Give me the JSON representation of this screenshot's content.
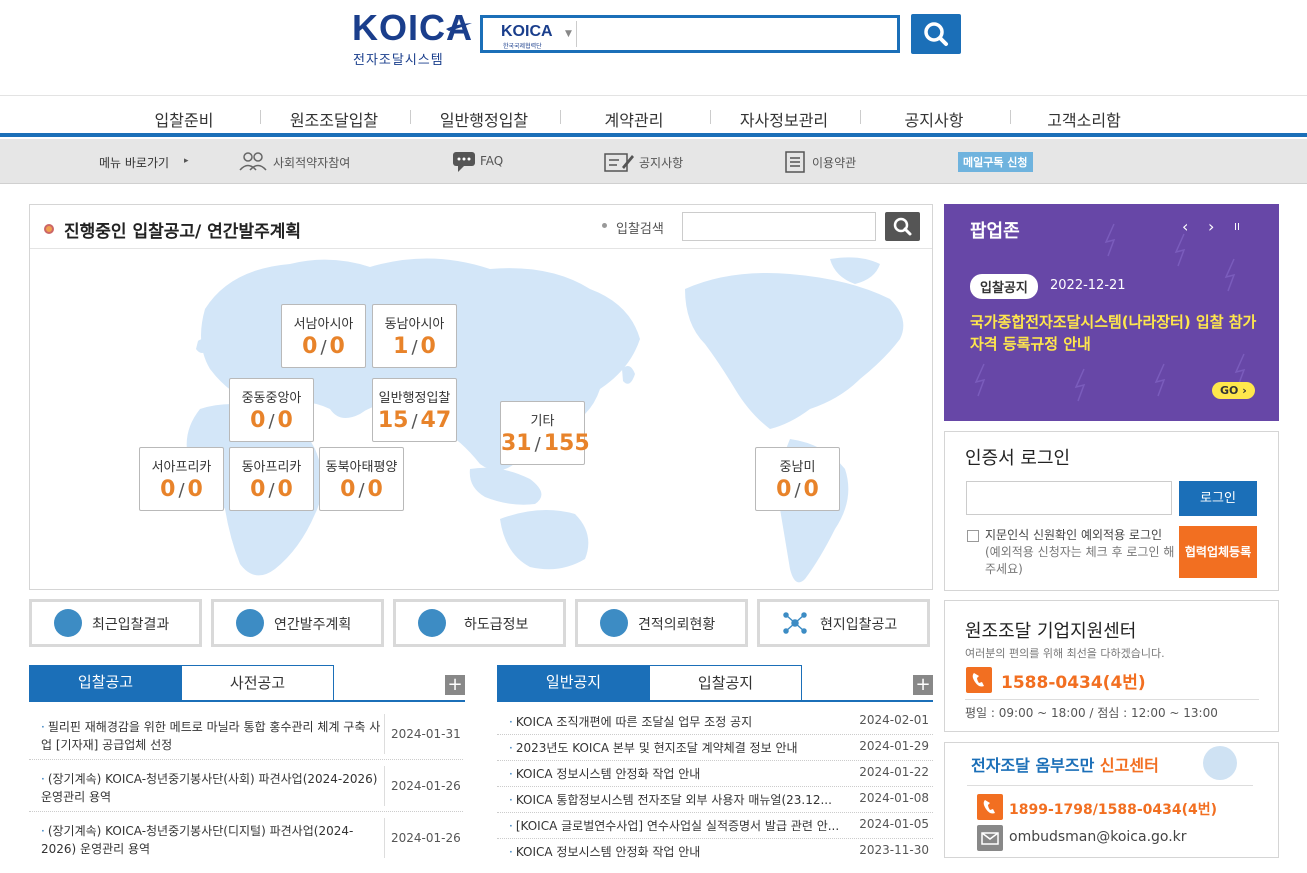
{
  "header": {
    "logo": "KOICA",
    "logo_sub": "전자조달시스템",
    "search_select_brand": "KOICA",
    "search_select_sub": "한국국제협력단"
  },
  "gnb": [
    "입찰준비",
    "원조조달입찰",
    "일반행정입찰",
    "계약관리",
    "자사정보관리",
    "공지사항",
    "고객소리함"
  ],
  "quickbar": {
    "label": "메뉴 바로가기",
    "items": [
      "사회적약자참여",
      "FAQ",
      "공지사항",
      "이용약관"
    ],
    "mail": "메일구독 신청"
  },
  "map_panel": {
    "title": "진행중인 입찰공고/ 연간발주계획",
    "search_label": "입찰검색",
    "regions": [
      {
        "name": "서남아시아",
        "a": "0",
        "b": "0"
      },
      {
        "name": "동남아시아",
        "a": "1",
        "b": "0"
      },
      {
        "name": "중동중앙아",
        "a": "0",
        "b": "0"
      },
      {
        "name": "일반행정입찰",
        "a": "15",
        "b": "47"
      },
      {
        "name": "기타",
        "a": "31",
        "b": "155"
      },
      {
        "name": "서아프리카",
        "a": "0",
        "b": "0"
      },
      {
        "name": "동아프리카",
        "a": "0",
        "b": "0"
      },
      {
        "name": "동북아태평양",
        "a": "0",
        "b": "0"
      },
      {
        "name": "중남미",
        "a": "0",
        "b": "0"
      }
    ]
  },
  "shortcuts": [
    "최근입찰결과",
    "연간발주계획",
    "하도급정보",
    "견적의뢰현황",
    "현지입찰공고"
  ],
  "bid_tabs": {
    "tabs": [
      "입찰공고",
      "사전공고"
    ],
    "rows": [
      {
        "title": "필리핀 재해경감을 위한 메트로 마닐라 통합 홍수관리 체계 구축 사업 [기자재] 공급업체 선정",
        "date": "2024-01-31"
      },
      {
        "title": "(장기계속) KOICA-청년중기봉사단(사회) 파견사업(2024-2026) 운영관리 용역",
        "date": "2024-01-26"
      },
      {
        "title": "(장기계속) KOICA-청년중기봉사단(디지털) 파견사업(2024-2026) 운영관리 용역",
        "date": "2024-01-26"
      }
    ]
  },
  "notice_tabs": {
    "tabs": [
      "일반공지",
      "입찰공지"
    ],
    "rows": [
      {
        "title": "KOICA 조직개편에 따른 조달실 업무 조정 공지",
        "date": "2024-02-01"
      },
      {
        "title": "2023년도 KOICA 본부 및 현지조달 계약체결 정보 안내",
        "date": "2024-01-29"
      },
      {
        "title": "KOICA 정보시스템 안정화 작업 안내",
        "date": "2024-01-22"
      },
      {
        "title": "KOICA 통합정보시스템 전자조달 외부 사용자 매뉴얼(23.12...",
        "date": "2024-01-08"
      },
      {
        "title": "[KOICA 글로벌연수사업] 연수사업실 실적증명서 발급 관련 안...",
        "date": "2024-01-05"
      },
      {
        "title": "KOICA 정보시스템 안정화 작업 안내",
        "date": "2023-11-30"
      }
    ]
  },
  "popup": {
    "title": "팝업존",
    "badge": "입찰공지",
    "date": "2022-12-21",
    "text": "국가종합전자조달시스템(나라장터) 입찰 참가자격 등록규정 안내",
    "go": "GO",
    "prev": "‹",
    "next": "›",
    "pause": "II"
  },
  "login": {
    "title": "인증서 로그인",
    "button": "로그인",
    "check_label": "지문인식 신원확인 예외적용 로그인",
    "hint": "(예외적용 신청자는 체크 후 로그인 해주세요)",
    "register": "협력업체등록"
  },
  "support": {
    "title": "원조조달 기업지원센터",
    "subtitle": "여러분의 편의를 위해 최선을 다하겠습니다.",
    "phone": "1588-0434(4번)",
    "hours": "평일 : 09:00 ~ 18:00 / 점심 : 12:00 ~ 13:00"
  },
  "ombudsman": {
    "title_a": "전자조달 옴부즈만 ",
    "title_b": "신고센터",
    "phone": "1899-1798/1588-0434(4번)",
    "email": "ombudsman@koica.go.kr"
  },
  "colors": {
    "primary": "#1b6fb8",
    "accent": "#f26f21",
    "popup": "#6747a7",
    "number": "#e8832a"
  }
}
